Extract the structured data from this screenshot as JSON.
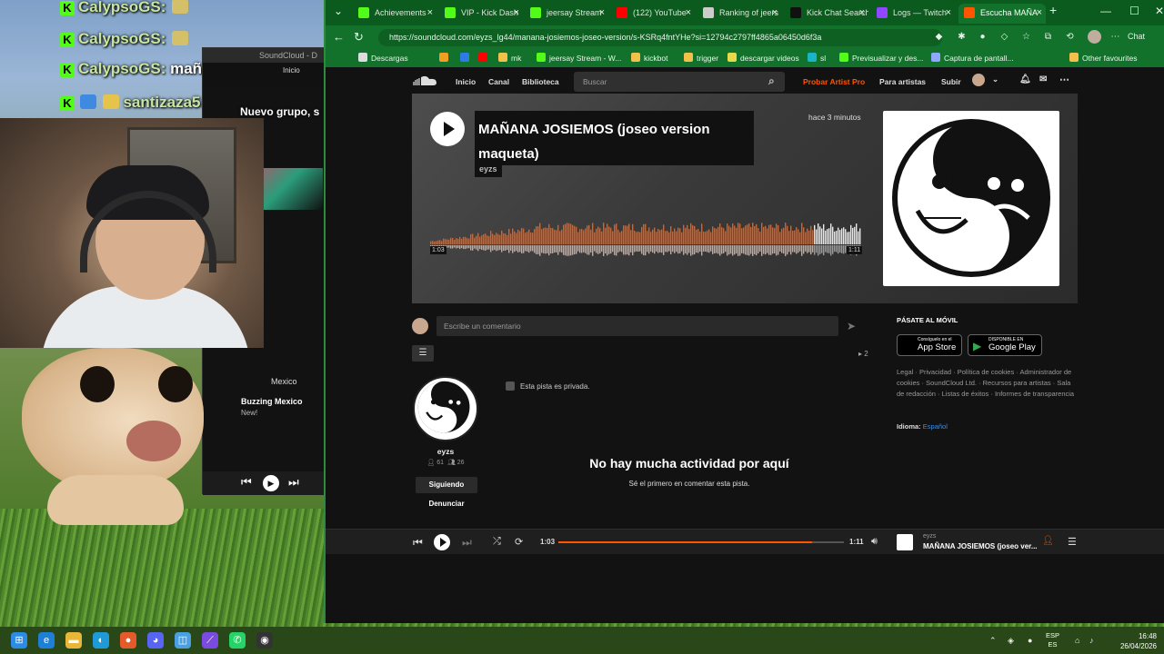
{
  "chat": [
    {
      "user": "CalypsoGS:",
      "message": "",
      "badge_color": "#d5c06a"
    },
    {
      "user": "CalypsoGS:",
      "message": "",
      "badge_color": "#d5c06a"
    },
    {
      "user": "CalypsoGS:",
      "message": "mañana josiemooos",
      "badge_color": ""
    },
    {
      "user": "santizaza5:",
      "message": "Nuevo grupo, s",
      "badge_color": "#3d8ae0"
    }
  ],
  "mini_player": {
    "window_title": "SoundCloud - D",
    "nav_item": "Inicio",
    "country": "Mexico",
    "playlist": "Buzzing Mexico",
    "tag": "New!"
  },
  "browser": {
    "tabs": [
      {
        "label": "Achievements",
        "icon": "kick-icon",
        "color": "#53fc18",
        "active": false
      },
      {
        "label": "VIP - Kick Dash",
        "icon": "kick-icon",
        "color": "#53fc18",
        "active": false
      },
      {
        "label": "jeersay Stream",
        "icon": "kick-icon",
        "color": "#53fc18",
        "active": false
      },
      {
        "label": "(122) YouTube",
        "icon": "youtube-icon",
        "color": "#ff0000",
        "active": false
      },
      {
        "label": "Ranking of jeers",
        "icon": "ranking-icon",
        "color": "#cccccc",
        "active": false
      },
      {
        "label": "Kick Chat Search",
        "icon": "kick-chat-icon",
        "color": "#111111",
        "active": false
      },
      {
        "label": "Logs — Twitch",
        "icon": "twitch-icon",
        "color": "#9146ff",
        "active": false
      },
      {
        "label": "Escucha MAÑA",
        "icon": "soundcloud-icon",
        "color": "#ff5500",
        "active": true
      }
    ],
    "url": "https://soundcloud.com/eyzs_lg44/manana-josiemos-joseo-version/s-KSRq4fntYHe?si=12794c2797ff4865a06450d6f3a",
    "profile_label": "Chat",
    "bookmarks": [
      {
        "label": "Descargas",
        "icon": "globe-icon",
        "color": "#dddddd"
      },
      {
        "label": "",
        "icon": "amazon-icon",
        "color": "#f0a020"
      },
      {
        "label": "",
        "icon": "app-icon",
        "color": "#2d7be5"
      },
      {
        "label": "",
        "icon": "youtube-icon",
        "color": "#ff0000"
      },
      {
        "label": "mk",
        "icon": "folder-icon",
        "color": "#f3c04c"
      },
      {
        "label": "jeersay Stream - W...",
        "icon": "kick-icon",
        "color": "#53fc18"
      },
      {
        "label": "kickbot",
        "icon": "bot-icon",
        "color": "#f3c04c"
      },
      {
        "label": "trigger",
        "icon": "folder-icon",
        "color": "#f3c04c"
      },
      {
        "label": "descargar videos",
        "icon": "download-icon",
        "color": "#e6d94a"
      },
      {
        "label": "sl",
        "icon": "link-icon",
        "color": "#19b4c7"
      },
      {
        "label": "Previsualizar y des...",
        "icon": "kick-icon",
        "color": "#53fc18"
      },
      {
        "label": "Captura de pantall...",
        "icon": "pen-icon",
        "color": "#8fa7ff"
      }
    ],
    "other_bookmarks": "Other favourites"
  },
  "soundcloud": {
    "nav": [
      "Inicio",
      "Canal",
      "Biblioteca"
    ],
    "search_placeholder": "Buscar",
    "pro_link": "Probar Artist Pro",
    "for_artists": "Para artistas",
    "upload": "Subir",
    "track": {
      "title": "MAÑANA JOSIEMOS (joseo version maqueta)",
      "artist": "eyzs",
      "posted": "hace 3 minutos",
      "current_time": "1:03",
      "duration": "1:11",
      "progress": 0.887
    },
    "comment_placeholder": "Escribe un comentario",
    "repost_count": "2",
    "private_note": "Esta pista es privada.",
    "artist": {
      "name": "eyzs",
      "followers": "61",
      "following": "26",
      "follow_button": "Siguiendo",
      "report_button": "Denunciar"
    },
    "empty_title": "No hay mucha actividad por aquí",
    "empty_subtitle": "Sé el primero en comentar esta pista.",
    "sidebar": {
      "title": "PÁSATE AL MÓVIL",
      "app_store_small": "Consíguelo en el",
      "app_store": "App Store",
      "google_play_small": "DISPONIBLE EN",
      "google_play": "Google Play",
      "legal": "Legal · Privacidad · Política de cookies · Administrador de cookies · SoundCloud Ltd. · Recursos para artistas · Sala de redacción · Listas de éxitos · Informes de transparencia",
      "language_label": "Idioma:",
      "language_value": "Español"
    }
  },
  "player": {
    "current_time": "1:03",
    "duration": "1:11",
    "progress": 0.887,
    "artist": "eyzs",
    "title": "MAÑANA JOSIEMOS (joseo ver..."
  },
  "taskbar": {
    "lang_top": "ESP",
    "lang_bottom": "ES",
    "time": "16:48",
    "date": "26/04/2026"
  }
}
